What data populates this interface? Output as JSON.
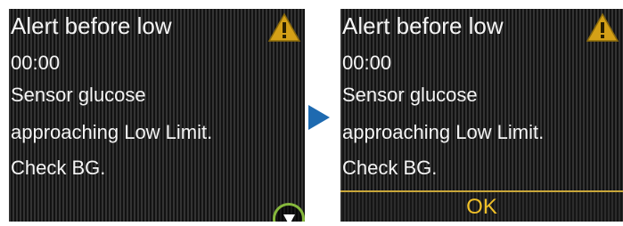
{
  "left_screen": {
    "title": "Alert before low",
    "time": "00:00",
    "message_line1": "Sensor glucose",
    "message_line2": "approaching Low Limit.",
    "message_line3": "Check BG."
  },
  "right_screen": {
    "title": "Alert before low",
    "time": "00:00",
    "message_line1": "Sensor glucose",
    "message_line2": "approaching Low Limit.",
    "message_line3": "Check BG.",
    "ok_label": "OK"
  },
  "icons": {
    "warning": "warning-triangle-icon",
    "scroll": "down-arrow-icon",
    "transition": "arrow-right-icon"
  },
  "colors": {
    "warning_yellow": "#d4a017",
    "ok_text": "#f0c028",
    "highlight_ring": "#86b83c",
    "transition_arrow": "#1e6ab0"
  }
}
